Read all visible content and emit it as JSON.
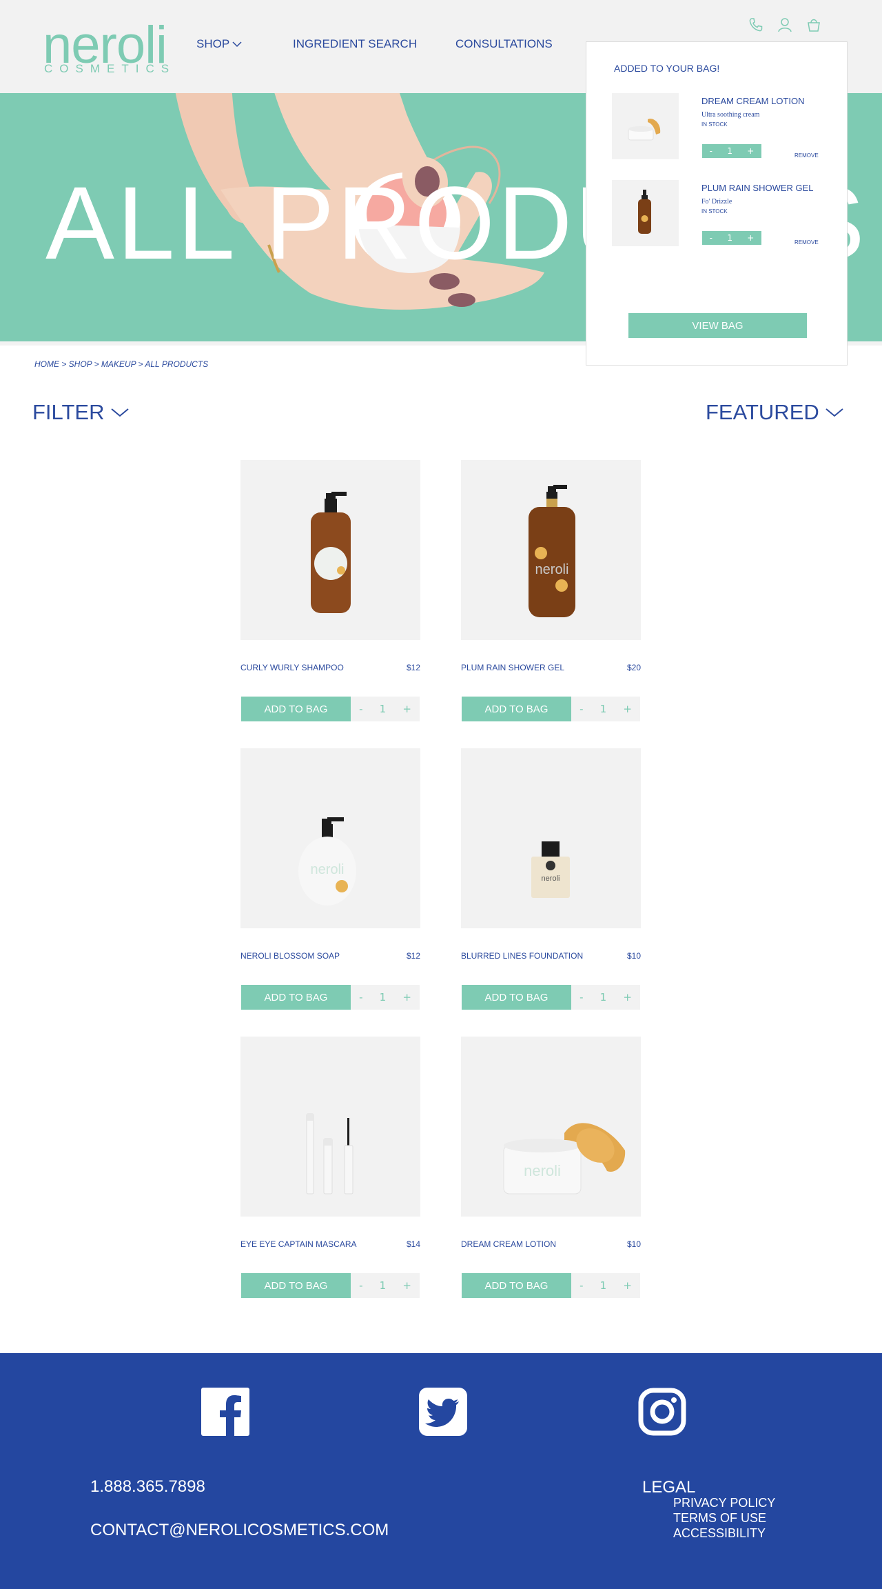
{
  "brand": {
    "name": "neroli",
    "subtitle": "COSMETICS",
    "accent_color": "#7ecbb3",
    "navy_color": "#2b4a9e"
  },
  "nav": {
    "shop": "SHOP",
    "ingredient_search": "INGREDIENT SEARCH",
    "consultations": "CONSULTATIONS"
  },
  "header_icons": [
    "phone-icon",
    "account-icon",
    "bag-icon"
  ],
  "hero": {
    "title": "ALL PRODUCTS"
  },
  "bag_popup": {
    "title": "ADDED TO YOUR BAG!",
    "items": [
      {
        "name": "DREAM CREAM LOTION",
        "desc": "Ultra soothing cream",
        "stock": "IN STOCK",
        "qty": "1",
        "minus": "-",
        "plus": "+",
        "remove": "REMOVE"
      },
      {
        "name": "PLUM RAIN SHOWER GEL",
        "desc": "Fo' Drizzle",
        "stock": "IN STOCK",
        "qty": "1",
        "minus": "-",
        "plus": "+",
        "remove": "REMOVE"
      }
    ],
    "view_bag": "VIEW BAG"
  },
  "breadcrumb": "HOME > SHOP > MAKEUP > ALL PRODUCTS",
  "filter_label": "FILTER",
  "sort_label": "FEATURED",
  "products": [
    {
      "name": "CURLY WURLY SHAMPOO",
      "price": "$12",
      "button": "ADD TO BAG",
      "qty": "1",
      "minus": "-",
      "plus": "+"
    },
    {
      "name": "PLUM RAIN SHOWER GEL",
      "price": "$20",
      "button": "ADD TO BAG",
      "qty": "1",
      "minus": "-",
      "plus": "+"
    },
    {
      "name": "NEROLI BLOSSOM SOAP",
      "price": "$12",
      "button": "ADD TO BAG",
      "qty": "1",
      "minus": "-",
      "plus": "+"
    },
    {
      "name": "BLURRED LINES FOUNDATION",
      "price": "$10",
      "button": "ADD TO BAG",
      "qty": "1",
      "minus": "-",
      "plus": "+"
    },
    {
      "name": "EYE EYE CAPTAIN MASCARA",
      "price": "$14",
      "button": "ADD TO BAG",
      "qty": "1",
      "minus": "-",
      "plus": "+"
    },
    {
      "name": "DREAM CREAM LOTION",
      "price": "$10",
      "button": "ADD TO BAG",
      "qty": "1",
      "minus": "-",
      "plus": "+"
    }
  ],
  "footer": {
    "social": [
      "facebook-icon",
      "twitter-icon",
      "instagram-icon"
    ],
    "phone": "1.888.365.7898",
    "email": "CONTACT@NEROLICOSMETICS.COM",
    "legal_title": "LEGAL",
    "legal_links": [
      "PRIVACY POLICY",
      "TERMS OF USE",
      "ACCESSIBILITY"
    ]
  }
}
